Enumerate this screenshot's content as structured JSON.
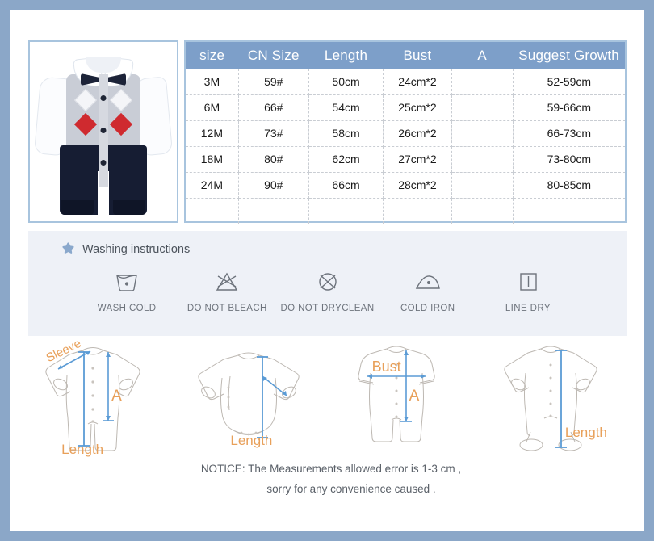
{
  "colors": {
    "outer_frame": "#8ba7c8",
    "table_header_bg": "#7d9fc9",
    "photo_border": "#a8c4de",
    "wash_band_bg": "#eef1f7",
    "measure_label": "#e8a05a",
    "measure_arrow": "#5b9bd5",
    "star_icon": "#8aa8cc"
  },
  "product_photo": {
    "alt": "baby boy romper with white shirt, grey argyle vest, navy bow tie and navy pants"
  },
  "size_table": {
    "headers": [
      "size",
      "CN Size",
      "Length",
      "Bust",
      "A",
      "Suggest Growth"
    ],
    "rows": [
      [
        "3M",
        "59#",
        "50cm",
        "24cm*2",
        "",
        "52-59cm"
      ],
      [
        "6M",
        "66#",
        "54cm",
        "25cm*2",
        "",
        "59-66cm"
      ],
      [
        "12M",
        "73#",
        "58cm",
        "26cm*2",
        "",
        "66-73cm"
      ],
      [
        "18M",
        "80#",
        "62cm",
        "27cm*2",
        "",
        "73-80cm"
      ],
      [
        "24M",
        "90#",
        "66cm",
        "28cm*2",
        "",
        "80-85cm"
      ],
      [
        "",
        "",
        "",
        "",
        "",
        ""
      ]
    ]
  },
  "washing": {
    "title": "Washing instructions",
    "items": [
      {
        "icon": "wash-cold-icon",
        "label": "WASH COLD"
      },
      {
        "icon": "do-not-bleach-icon",
        "label": "DO NOT BLEACH"
      },
      {
        "icon": "do-not-dryclean-icon",
        "label": "DO NOT DRYCLEAN"
      },
      {
        "icon": "cold-iron-icon",
        "label": "COLD IRON"
      },
      {
        "icon": "line-dry-icon",
        "label": "LINE DRY"
      }
    ]
  },
  "diagrams": [
    {
      "name": "long-sleeve-romper",
      "labels": {
        "a": "Sleeve",
        "b": "A",
        "c": "Length"
      }
    },
    {
      "name": "long-sleeve-bodysuit",
      "labels": {
        "c": "Length"
      }
    },
    {
      "name": "short-sleeve-romper",
      "labels": {
        "bust": "Bust",
        "b": "A"
      }
    },
    {
      "name": "footed-romper",
      "labels": {
        "c": "Length"
      }
    }
  ],
  "notice": {
    "line1": "NOTICE:   The Measurements allowed error is 1-3 cm ,",
    "line2": "sorry for any convenience caused ."
  }
}
